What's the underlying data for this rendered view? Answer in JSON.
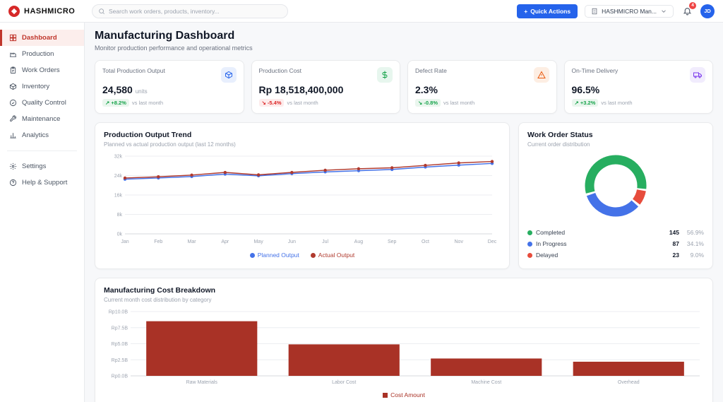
{
  "brand": {
    "name": "HASHMICRO"
  },
  "header": {
    "search_placeholder": "Search work orders, products, inventory...",
    "quick_actions": {
      "plus": "+",
      "label": "Quick Actions"
    },
    "company": {
      "label": "HASHMICRO Man..."
    },
    "notifications": {
      "count": "4"
    },
    "avatar": {
      "initials": "JD"
    }
  },
  "sidebar": {
    "items": [
      {
        "label": "Dashboard"
      },
      {
        "label": "Production"
      },
      {
        "label": "Work Orders"
      },
      {
        "label": "Inventory"
      },
      {
        "label": "Quality Control"
      },
      {
        "label": "Maintenance"
      },
      {
        "label": "Analytics"
      }
    ],
    "footer_items": [
      {
        "label": "Settings"
      },
      {
        "label": "Help & Support"
      }
    ]
  },
  "page": {
    "title": "Manufacturing Dashboard",
    "subtitle": "Monitor production performance and operational metrics"
  },
  "kpis": [
    {
      "label": "Total Production Output",
      "value": "24,580",
      "unit": "units",
      "delta_arrow": "↗",
      "delta": "+8.2%",
      "delta_color": "#16a34a",
      "delta_bg": "#eaf6ee",
      "note": "vs last month",
      "accent": "#2563eb",
      "icon_bg": "#e8effd"
    },
    {
      "label": "Production Cost",
      "value": "Rp 18,518,400,000",
      "unit": "",
      "delta_arrow": "↘",
      "delta": "-5.4%",
      "delta_color": "#dc2626",
      "delta_bg": "#fdecec",
      "note": "vs last month",
      "accent": "#16a34a",
      "icon_bg": "#e7f6ee"
    },
    {
      "label": "Defect Rate",
      "value": "2.3%",
      "unit": "",
      "delta_arrow": "↘",
      "delta": "-0.8%",
      "delta_color": "#16a34a",
      "delta_bg": "#eaf6ee",
      "note": "vs last month",
      "accent": "#ea580c",
      "icon_bg": "#fdeee3"
    },
    {
      "label": "On-Time Delivery",
      "value": "96.5%",
      "unit": "",
      "delta_arrow": "↗",
      "delta": "+3.2%",
      "delta_color": "#16a34a",
      "delta_bg": "#eaf6ee",
      "note": "vs last month",
      "accent": "#7c3aed",
      "icon_bg": "#f1ecfd"
    }
  ],
  "chart_data": [
    {
      "id": "production_output_trend",
      "type": "line",
      "title": "Production Output Trend",
      "subtitle": "Planned vs actual production output (last 12 months)",
      "x": [
        "Jan",
        "Feb",
        "Mar",
        "Apr",
        "May",
        "Jun",
        "Jul",
        "Aug",
        "Sep",
        "Oct",
        "Nov",
        "Dec"
      ],
      "series": [
        {
          "name": "Planned Output",
          "color": "#4472e8",
          "values": [
            22500,
            23000,
            23600,
            24600,
            23900,
            24800,
            25500,
            26000,
            26500,
            27500,
            28300,
            29000
          ]
        },
        {
          "name": "Actual Output",
          "color": "#b03a2e",
          "values": [
            23000,
            23500,
            24200,
            25300,
            24300,
            25300,
            26200,
            26800,
            27200,
            28200,
            29200,
            29800
          ]
        }
      ],
      "ylim": [
        0,
        32000
      ],
      "yticks": [
        "0k",
        "8k",
        "16k",
        "24k",
        "32k"
      ],
      "legend_position": "bottom",
      "grid": true
    },
    {
      "id": "work_order_status",
      "type": "pie",
      "title": "Work Order Status",
      "subtitle": "Current order distribution",
      "slices": [
        {
          "label": "Completed",
          "value": 145,
          "pct": "56.9%",
          "color": "#27ae60"
        },
        {
          "label": "In Progress",
          "value": 87,
          "pct": "34.1%",
          "color": "#4472e8"
        },
        {
          "label": "Delayed",
          "value": 23,
          "pct": "9.0%",
          "color": "#e74c3c"
        }
      ]
    },
    {
      "id": "manufacturing_cost_breakdown",
      "type": "bar",
      "title": "Manufacturing Cost Breakdown",
      "subtitle": "Current month cost distribution by category",
      "categories": [
        "Raw Materials",
        "Labor Cost",
        "Machine Cost",
        "Overhead"
      ],
      "values": [
        8.5,
        4.9,
        2.7,
        2.2
      ],
      "bar_color": "#a93226",
      "ylim": [
        0,
        10
      ],
      "yticks": [
        "Rp0.0B",
        "Rp2.5B",
        "Rp5.0B",
        "Rp7.5B",
        "Rp10.0B"
      ],
      "legend": "Cost Amount",
      "grid": true
    }
  ]
}
